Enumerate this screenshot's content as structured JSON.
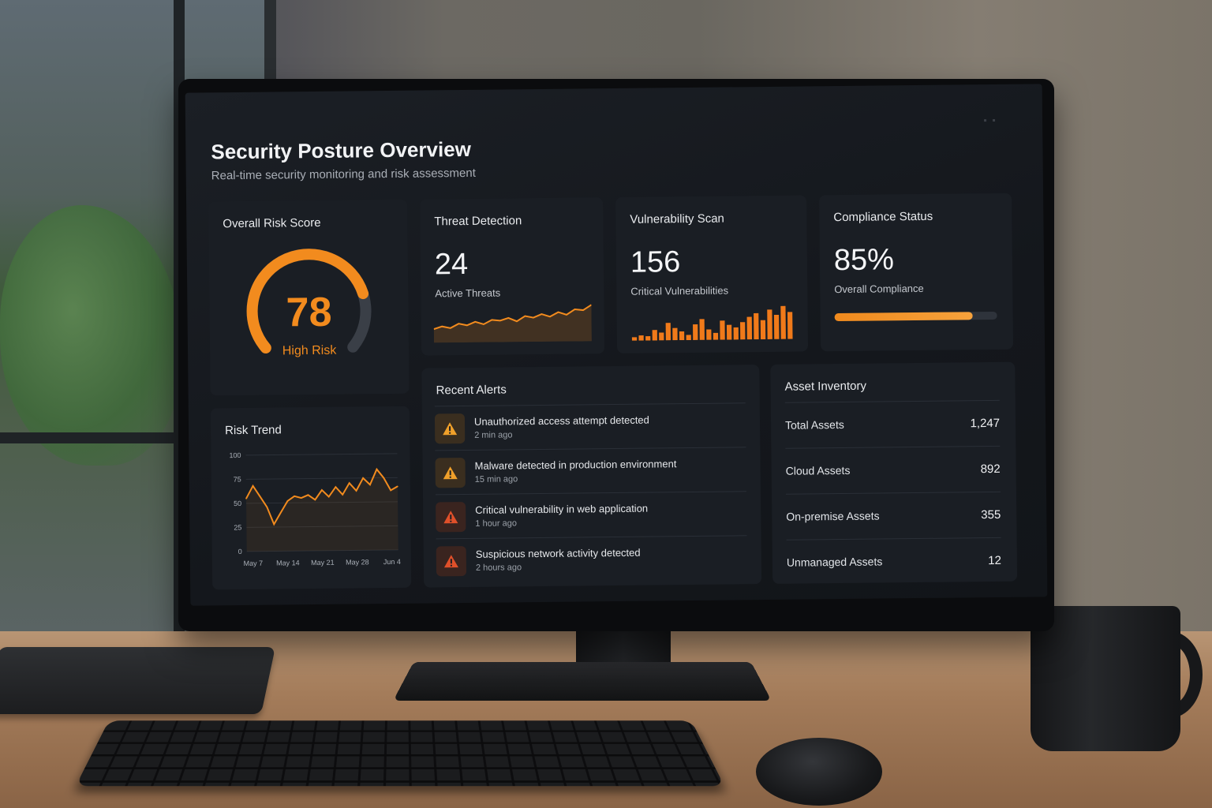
{
  "header": {
    "title": "Security Posture Overview",
    "subtitle": "Real-time security monitoring and risk assessment"
  },
  "colors": {
    "accent": "#f28b1e",
    "card_bg": "#1a1e24",
    "screen_bg": "#14171c",
    "warning": "#f0a02a",
    "critical": "#e0502a"
  },
  "risk_score": {
    "title": "Overall Risk Score",
    "value": "78",
    "value_fraction": 0.78,
    "label": "High Risk"
  },
  "threat_detection": {
    "title": "Threat Detection",
    "value": "24",
    "label": "Active Threats",
    "sparkline": [
      12,
      15,
      13,
      18,
      16,
      20,
      17,
      22,
      21,
      24,
      20,
      26,
      24,
      28,
      25,
      30,
      27,
      33,
      32,
      38
    ]
  },
  "vulnerability_scan": {
    "title": "Vulnerability Scan",
    "value": "156",
    "label": "Critical Vulnerabilities",
    "bars": [
      4,
      6,
      5,
      12,
      9,
      20,
      14,
      10,
      6,
      18,
      24,
      12,
      8,
      22,
      17,
      14,
      20,
      26,
      30,
      22,
      34,
      28,
      38,
      31
    ]
  },
  "compliance": {
    "title": "Compliance Status",
    "value": "85%",
    "label": "Overall Compliance",
    "progress": 0.85
  },
  "risk_trend": {
    "title": "Risk Trend"
  },
  "chart_data": {
    "type": "line",
    "title": "Risk Trend",
    "xlabel": "",
    "ylabel": "",
    "ylim": [
      0,
      100
    ],
    "yticks": [
      "100",
      "75",
      "50",
      "25",
      "0"
    ],
    "xticks": [
      "May 7",
      "May 14",
      "May 21",
      "May 28",
      "Jun 4"
    ],
    "grid": true,
    "series": [
      {
        "values": [
          55,
          68,
          57,
          46,
          28,
          40,
          52,
          57,
          55,
          58,
          53,
          63,
          56,
          66,
          58,
          70,
          62,
          75,
          68,
          84,
          75,
          62,
          66
        ]
      }
    ]
  },
  "alerts": {
    "title": "Recent Alerts",
    "items": [
      {
        "title": "Unauthorized access attempt detected",
        "time": "2 min ago",
        "severity": "warning",
        "icon": "warning-triangle-icon"
      },
      {
        "title": "Malware detected in production environment",
        "time": "15 min ago",
        "severity": "warning",
        "icon": "warning-triangle-icon"
      },
      {
        "title": "Critical vulnerability in web application",
        "time": "1 hour ago",
        "severity": "critical",
        "icon": "warning-triangle-icon"
      },
      {
        "title": "Suspicious network activity detected",
        "time": "2 hours ago",
        "severity": "critical",
        "icon": "warning-triangle-icon"
      }
    ]
  },
  "assets": {
    "title": "Asset Inventory",
    "items": [
      {
        "label": "Total Assets",
        "value": "1,247"
      },
      {
        "label": "Cloud Assets",
        "value": "892"
      },
      {
        "label": "On-premise Assets",
        "value": "355"
      },
      {
        "label": "Unmanaged Assets",
        "value": "12"
      }
    ]
  }
}
